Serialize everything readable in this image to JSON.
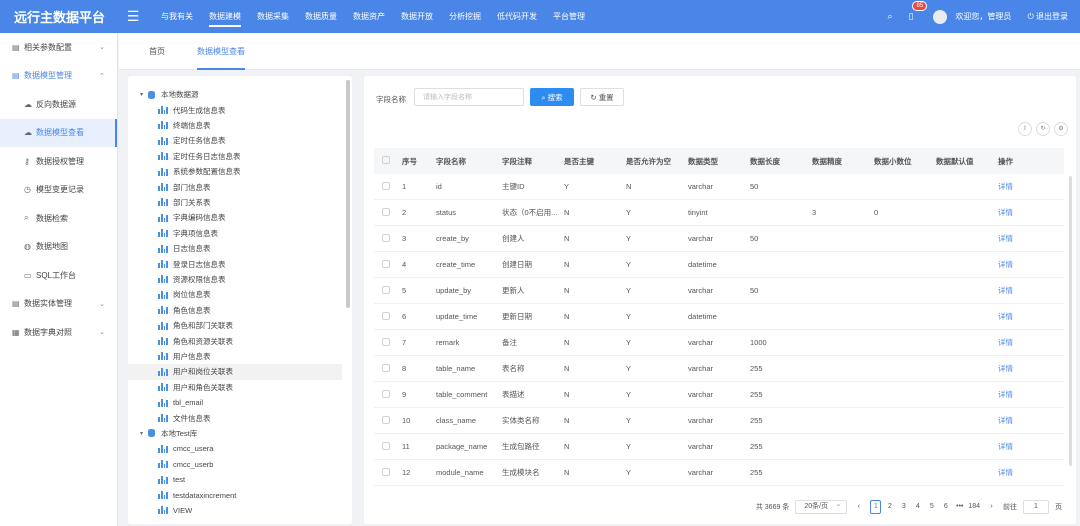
{
  "app": {
    "title": "远行主数据平台"
  },
  "topnav": {
    "items": [
      "与我有关",
      "数据建模",
      "数据采集",
      "数据质量",
      "数据资产",
      "数据开放",
      "分析挖掘",
      "低代码开发",
      "平台管理"
    ],
    "active_index": 1,
    "notification_count": "85",
    "welcome": "欢迎您，管理员",
    "logout": "退出登录"
  },
  "sidebar": {
    "items": [
      {
        "label": "相关参数配置",
        "icon": "document-icon",
        "type": "group"
      },
      {
        "label": "数据模型管理",
        "icon": "document-icon",
        "type": "group-open"
      },
      {
        "label": "反向数据源",
        "icon": "cloud-icon",
        "type": "sub"
      },
      {
        "label": "数据模型查看",
        "icon": "cloud-upload-icon",
        "type": "sub-active"
      },
      {
        "label": "数据授权管理",
        "icon": "user-key-icon",
        "type": "sub"
      },
      {
        "label": "模型变更记录",
        "icon": "history-icon",
        "type": "sub"
      },
      {
        "label": "数据检索",
        "icon": "file-search-icon",
        "type": "sub"
      },
      {
        "label": "数据地图",
        "icon": "globe-icon",
        "type": "sub"
      },
      {
        "label": "SQL工作台",
        "icon": "monitor-icon",
        "type": "sub"
      },
      {
        "label": "数据实体管理",
        "icon": "document-icon",
        "type": "group"
      },
      {
        "label": "数据字典对照",
        "icon": "dictionary-icon",
        "type": "group"
      }
    ]
  },
  "tabs": [
    "首页",
    "数据模型查看"
  ],
  "tree": {
    "nodes": [
      {
        "label": "本地数据源",
        "kind": "db"
      },
      {
        "label": "代码生成信息表",
        "kind": "table"
      },
      {
        "label": "终端信息表",
        "kind": "table"
      },
      {
        "label": "定时任务信息表",
        "kind": "table"
      },
      {
        "label": "定时任务日志信息表",
        "kind": "table"
      },
      {
        "label": "系统参数配置信息表",
        "kind": "table"
      },
      {
        "label": "部门信息表",
        "kind": "table"
      },
      {
        "label": "部门关系表",
        "kind": "table"
      },
      {
        "label": "字典编码信息表",
        "kind": "table"
      },
      {
        "label": "字典项信息表",
        "kind": "table"
      },
      {
        "label": "日志信息表",
        "kind": "table"
      },
      {
        "label": "登录日志信息表",
        "kind": "table"
      },
      {
        "label": "资源权限信息表",
        "kind": "table"
      },
      {
        "label": "岗位信息表",
        "kind": "table"
      },
      {
        "label": "角色信息表",
        "kind": "table"
      },
      {
        "label": "角色和部门关联表",
        "kind": "table"
      },
      {
        "label": "角色和资源关联表",
        "kind": "table"
      },
      {
        "label": "用户信息表",
        "kind": "table"
      },
      {
        "label": "用户和岗位关联表",
        "kind": "table",
        "highlight": true
      },
      {
        "label": "用户和角色关联表",
        "kind": "table"
      },
      {
        "label": "tbl_email",
        "kind": "table"
      },
      {
        "label": "文件信息表",
        "kind": "table"
      },
      {
        "label": "本地Test库",
        "kind": "db"
      },
      {
        "label": "cmcc_usera",
        "kind": "table"
      },
      {
        "label": "cmcc_userb",
        "kind": "table"
      },
      {
        "label": "test",
        "kind": "table"
      },
      {
        "label": "testdataxincrement",
        "kind": "table"
      },
      {
        "label": "VIEW",
        "kind": "table"
      }
    ]
  },
  "search": {
    "label": "字段名称",
    "placeholder": "请输入字段名称",
    "search_button": "搜索",
    "reset_button": "重置"
  },
  "table": {
    "columns": [
      "序号",
      "字段名称",
      "字段注释",
      "是否主键",
      "是否允许为空",
      "数据类型",
      "数据长度",
      "数据精度",
      "数据小数位",
      "数据默认值",
      "操作"
    ],
    "rows": [
      [
        "1",
        "id",
        "主键ID",
        "Y",
        "N",
        "varchar",
        "50",
        "",
        "",
        "",
        "详情"
      ],
      [
        "2",
        "status",
        "状态（0不启用...",
        "N",
        "Y",
        "tinyint",
        "",
        "3",
        "0",
        "",
        "详情"
      ],
      [
        "3",
        "create_by",
        "创建人",
        "N",
        "Y",
        "varchar",
        "50",
        "",
        "",
        "",
        "详情"
      ],
      [
        "4",
        "create_time",
        "创建日期",
        "N",
        "Y",
        "datetime",
        "",
        "",
        "",
        "",
        "详情"
      ],
      [
        "5",
        "update_by",
        "更新人",
        "N",
        "Y",
        "varchar",
        "50",
        "",
        "",
        "",
        "详情"
      ],
      [
        "6",
        "update_time",
        "更新日期",
        "N",
        "Y",
        "datetime",
        "",
        "",
        "",
        "",
        "详情"
      ],
      [
        "7",
        "remark",
        "备注",
        "N",
        "Y",
        "varchar",
        "1000",
        "",
        "",
        "",
        "详情"
      ],
      [
        "8",
        "table_name",
        "表名称",
        "N",
        "Y",
        "varchar",
        "255",
        "",
        "",
        "",
        "详情"
      ],
      [
        "9",
        "table_comment",
        "表描述",
        "N",
        "Y",
        "varchar",
        "255",
        "",
        "",
        "",
        "详情"
      ],
      [
        "10",
        "class_name",
        "实体类名称",
        "N",
        "Y",
        "varchar",
        "255",
        "",
        "",
        "",
        "详情"
      ],
      [
        "11",
        "package_name",
        "生成包路径",
        "N",
        "Y",
        "varchar",
        "255",
        "",
        "",
        "",
        "详情"
      ],
      [
        "12",
        "module_name",
        "生成模块名",
        "N",
        "Y",
        "varchar",
        "255",
        "",
        "",
        "",
        "详情"
      ]
    ]
  },
  "pagination": {
    "total": "共 3669 条",
    "page_size": "20条/页",
    "prev": "‹",
    "pages": [
      "1",
      "2",
      "3",
      "4",
      "5",
      "6",
      "•••",
      "184"
    ],
    "current": "1",
    "next": "›",
    "goto_label": "前往",
    "goto_value": "1",
    "goto_suffix": "页"
  }
}
